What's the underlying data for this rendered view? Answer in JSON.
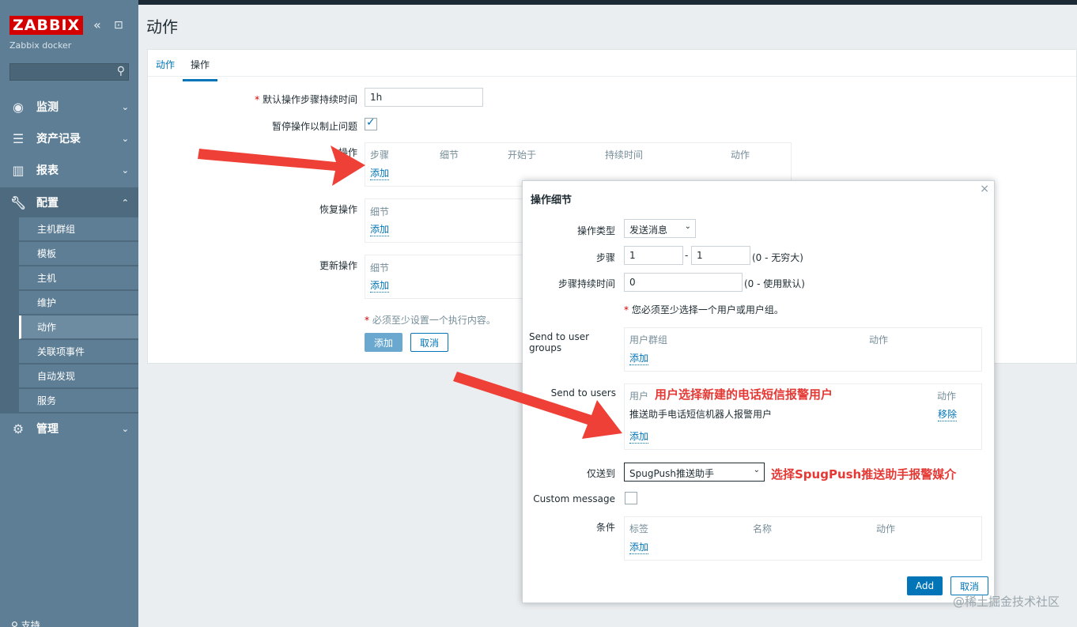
{
  "app": {
    "logo": "ZABBIX",
    "server_name": "Zabbix docker",
    "collapse_icon": "«",
    "kiosk_icon": "⊡"
  },
  "sidebar": {
    "search_placeholder": "",
    "items": [
      {
        "label": "监测",
        "icon": "eye-icon"
      },
      {
        "label": "资产记录",
        "icon": "list-icon"
      },
      {
        "label": "报表",
        "icon": "bar-chart-icon"
      },
      {
        "label": "配置",
        "icon": "wrench-icon"
      },
      {
        "label": "管理",
        "icon": "gear-icon"
      }
    ],
    "sub_items": [
      "主机群组",
      "模板",
      "主机",
      "维护",
      "动作",
      "关联项事件",
      "自动发现",
      "服务"
    ],
    "support_label": "支持"
  },
  "page": {
    "title": "动作"
  },
  "tabs": [
    "动作",
    "操作"
  ],
  "form": {
    "default_step_duration_label": "默认操作步骤持续时间",
    "default_step_duration_value": "1h",
    "pause_label": "暂停操作以制止问题",
    "operations_label": "操作",
    "operations_headers": [
      "步骤",
      "细节",
      "开始于",
      "持续时间",
      "动作"
    ],
    "add_link": "添加",
    "recovery_label": "恢复操作",
    "recovery_header": "细节",
    "update_label": "更新操作",
    "update_header": "细节",
    "required_note": "必须至少设置一个执行内容。",
    "add_button": "添加",
    "cancel_button": "取消"
  },
  "modal": {
    "title": "操作细节",
    "operation_type_label": "操作类型",
    "operation_type_value": "发送消息",
    "steps_label": "步骤",
    "step_from": "1",
    "step_dash": "-",
    "step_to": "1",
    "steps_hint": "(0 - 无穷大)",
    "step_duration_label": "步骤持续时间",
    "step_duration_value": "0",
    "step_duration_hint": "(0 - 使用默认)",
    "user_required_note": "您必须至少选择一个用户或用户组。",
    "send_groups_label": "Send to user groups",
    "groups_headers": [
      "用户群组",
      "动作"
    ],
    "send_users_label": "Send to users",
    "users_headers": [
      "用户",
      "动作"
    ],
    "user_row": {
      "name": "推送助手电话短信机器人报警用户",
      "action": "移除"
    },
    "send_only_label": "仅送到",
    "send_only_value": "SpugPush推送助手",
    "custom_message_label": "Custom message",
    "conditions_label": "条件",
    "conditions_headers": [
      "标签",
      "名称",
      "动作"
    ],
    "add_link": "添加",
    "add_button": "Add",
    "cancel_button": "取消"
  },
  "annotations": {
    "users_note": "用户选择新建的电话短信报警用户",
    "media_note": "选择SpugPush推送助手报警媒介"
  },
  "watermark": "@稀土掘金技术社区",
  "colors": {
    "sidebar": "#5e7e95",
    "accent": "#0275b8",
    "annotation": "#e53935",
    "logo": "#d40000"
  }
}
